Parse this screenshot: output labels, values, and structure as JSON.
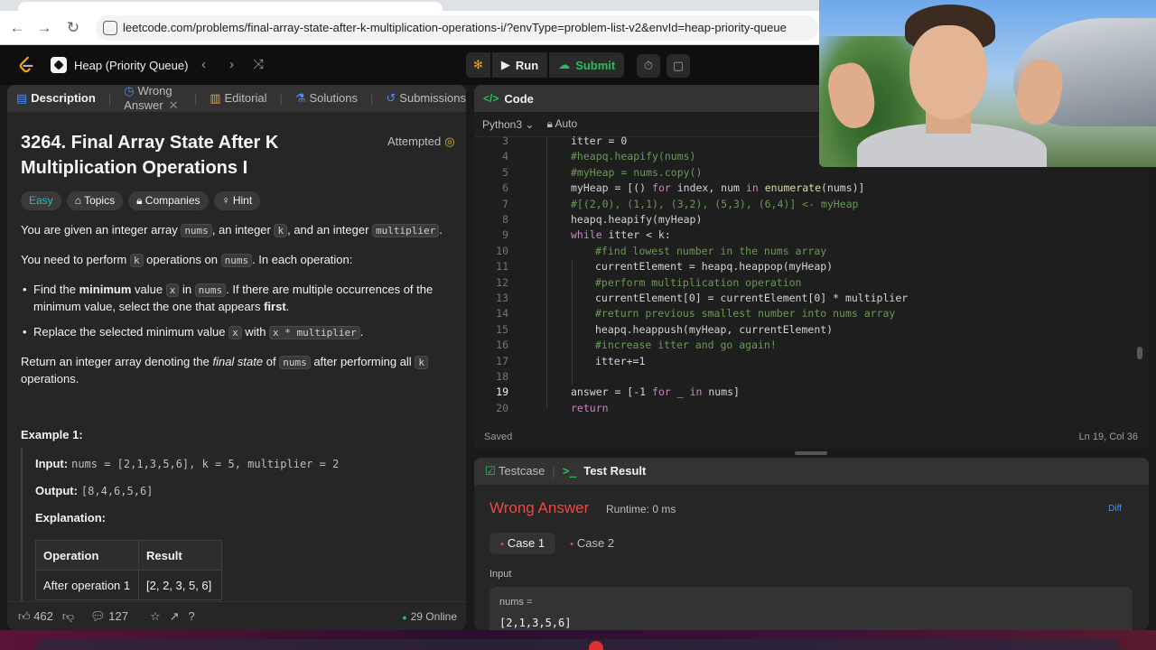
{
  "browser": {
    "url": "leetcode.com/problems/final-array-state-after-k-multiplication-operations-i/?envType=problem-list-v2&envId=heap-priority-queue"
  },
  "toolbar": {
    "problem_list": "Heap (Priority Queue)",
    "run_label": "Run",
    "submit_label": "Submit"
  },
  "left_tabs": {
    "description": "Description",
    "wrong_answer": "Wrong Answer",
    "editorial": "Editorial",
    "solutions": "Solutions",
    "submissions": "Submissions"
  },
  "problem": {
    "title": "3264. Final Array State After K Multiplication Operations I",
    "status": "Attempted",
    "chips": {
      "difficulty": "Easy",
      "topics": "Topics",
      "companies": "Companies",
      "hint": "Hint"
    },
    "p1": {
      "a": "You are given an integer array ",
      "c1": "nums",
      "b": ", an integer ",
      "c2": "k",
      "c": ", and an integer ",
      "c3": "multiplier",
      "d": "."
    },
    "p2": {
      "a": "You need to perform ",
      "c1": "k",
      "b": " operations on ",
      "c2": "nums",
      "c": ". In each operation:"
    },
    "b1": {
      "a": "Find the ",
      "bold1": "minimum",
      "b": " value ",
      "c1": "x",
      "c": " in ",
      "c2": "nums",
      "d": ". If there are multiple occurrences of the minimum value, select the one that appears ",
      "bold2": "first",
      "e": "."
    },
    "b2": {
      "a": "Replace the selected minimum value ",
      "c1": "x",
      "b": " with ",
      "c2": "x * multiplier",
      "c": "."
    },
    "p3": {
      "a": "Return an integer array denoting the ",
      "em": "final state",
      "b": " of ",
      "c1": "nums",
      "c": " after performing all ",
      "c2": "k",
      "d": " operations."
    },
    "example": {
      "title": "Example 1:",
      "input_label": "Input:",
      "input": "nums = [2,1,3,5,6], k = 5, multiplier = 2",
      "output_label": "Output:",
      "output": "[8,4,6,5,6]",
      "explanation_label": "Explanation:",
      "table_headers": [
        "Operation",
        "Result"
      ],
      "table_rows": [
        [
          "After operation 1",
          "[2, 2, 3, 5, 6]"
        ]
      ]
    }
  },
  "left_footer": {
    "likes": "462",
    "comments": "127",
    "online": "29 Online"
  },
  "code": {
    "header": "Code",
    "language": "Python3",
    "mode": "Auto",
    "lines": [
      {
        "n": "3",
        "text": "itter = 0"
      },
      {
        "n": "4",
        "text": "#heapq.heapify(nums)"
      },
      {
        "n": "5",
        "text": "#myHeap = nums.copy()"
      },
      {
        "n": "6",
        "text": "myHeap = [() for index, num in enumerate(nums)]"
      },
      {
        "n": "7",
        "text": "#[(2,0), (1,1), (3,2), (5,3), (6,4)] <- myHeap"
      },
      {
        "n": "8",
        "text": "heapq.heapify(myHeap)"
      },
      {
        "n": "9",
        "text": "while itter < k:"
      },
      {
        "n": "10",
        "text": "#find lowest number in the nums array"
      },
      {
        "n": "11",
        "text": "currentElement = heapq.heappop(myHeap)"
      },
      {
        "n": "12",
        "text": "#perform multiplication operation"
      },
      {
        "n": "13",
        "text": "currentElement[0] = currentElement[0] * multiplier"
      },
      {
        "n": "14",
        "text": "#return previous smallest number into nums array"
      },
      {
        "n": "15",
        "text": "heapq.heappush(myHeap, currentElement)"
      },
      {
        "n": "16",
        "text": "#increase itter and go again!"
      },
      {
        "n": "17",
        "text": "itter+=1"
      },
      {
        "n": "18",
        "text": ""
      },
      {
        "n": "19",
        "text": "answer = [-1 for _ in nums]"
      },
      {
        "n": "20",
        "text": "return"
      }
    ],
    "saved": "Saved",
    "cursor": "Ln 19, Col 36"
  },
  "result": {
    "testcase_tab": "Testcase",
    "result_tab": "Test Result",
    "verdict": "Wrong Answer",
    "runtime": "Runtime: 0 ms",
    "diff": "Diff",
    "cases": [
      "Case 1",
      "Case 2"
    ],
    "input_label": "Input",
    "input_name": "nums =",
    "input_value": "[2,1,3,5,6]"
  }
}
